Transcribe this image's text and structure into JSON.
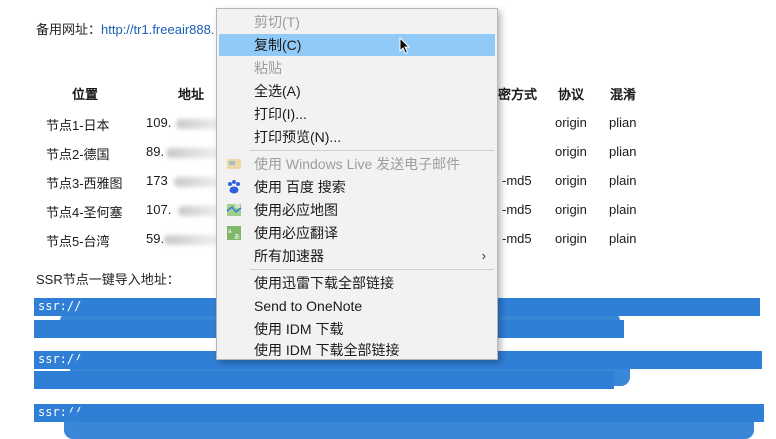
{
  "backup": {
    "label": "备用网址：",
    "url": "http://tr1.freeair888."
  },
  "table": {
    "headers": {
      "position": "位置",
      "address": "地址",
      "method": "密方式",
      "protocol": "协议",
      "obfs": "混淆"
    },
    "rows": [
      {
        "name": "节点1-日本",
        "addr": "109.",
        "method": "",
        "protocol": "origin",
        "obfs": "plian"
      },
      {
        "name": "节点2-德国",
        "addr": "89.",
        "method": "",
        "protocol": "origin",
        "obfs": "plian"
      },
      {
        "name": "节点3-西雅图",
        "addr": "173",
        "method": "-md5",
        "protocol": "origin",
        "obfs": "plain"
      },
      {
        "name": "节点4-圣何塞",
        "addr": "107.",
        "method": "-md5",
        "protocol": "origin",
        "obfs": "plain"
      },
      {
        "name": "节点5-台湾",
        "addr": "59.",
        "method": "-md5",
        "protocol": "origin",
        "obfs": "plain"
      }
    ]
  },
  "import": {
    "label": "SSR节点一键导入地址：",
    "links": [
      "ssr://",
      "ssr://",
      "ssr://"
    ]
  },
  "context_menu": {
    "items": [
      {
        "label": "剪切(T)",
        "disabled": true
      },
      {
        "label": "复制(C)",
        "hover": true
      },
      {
        "label": "粘贴",
        "disabled": true
      },
      {
        "label": "全选(A)"
      },
      {
        "label": "打印(I)..."
      },
      {
        "label": "打印预览(N)..."
      },
      {
        "label": "使用 Windows Live 发送电子邮件",
        "disabled": true,
        "icon": "windows-live-mail-icon"
      },
      {
        "label": "使用 百度 搜索",
        "icon": "baidu-paw-icon"
      },
      {
        "label": "使用必应地图",
        "icon": "bing-maps-icon"
      },
      {
        "label": "使用必应翻译",
        "icon": "bing-translator-icon"
      },
      {
        "label": "所有加速器",
        "submenu_arrow": "›"
      },
      {
        "label": "使用迅雷下载全部链接"
      },
      {
        "label": "Send to OneNote"
      },
      {
        "label": "使用 IDM 下载"
      },
      {
        "label": "使用 IDM 下载全部链接"
      }
    ]
  },
  "colors": {
    "hover": "#91c9f7",
    "link": "#1a5fb4",
    "selection": "#2f7fd6",
    "menu_bg": "#f2f2f2"
  }
}
